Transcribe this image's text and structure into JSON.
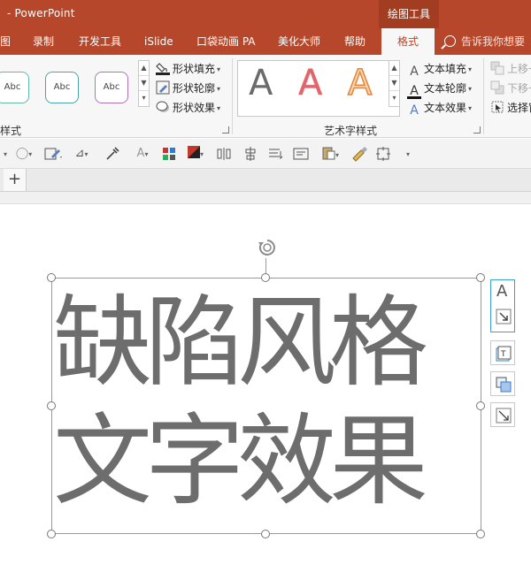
{
  "titlebar": {
    "title": "- PowerPoint",
    "context_group": "绘图工具"
  },
  "tabs": [
    {
      "label": "图",
      "active": false
    },
    {
      "label": "录制",
      "active": false
    },
    {
      "label": "开发工具",
      "active": false
    },
    {
      "label": "iSlide",
      "active": false
    },
    {
      "label": "口袋动画 PA",
      "active": false
    },
    {
      "label": "美化大师",
      "active": false
    },
    {
      "label": "帮助",
      "active": false
    },
    {
      "label": "格式",
      "active": true
    }
  ],
  "tell_me": "告诉我你想要",
  "shape_styles": {
    "thumbs": [
      {
        "label": "Abc",
        "border": "#5fb9a4"
      },
      {
        "label": "Abc",
        "border": "#4aa3a8"
      },
      {
        "label": "Abc",
        "border": "#b46fc0"
      }
    ],
    "fill": "形状填充",
    "outline": "形状轮廓",
    "effects": "形状效果",
    "group_label": "样式"
  },
  "wordart": {
    "samples": [
      {
        "letter": "A",
        "style": "gray"
      },
      {
        "letter": "A",
        "style": "red"
      },
      {
        "letter": "A",
        "style": "orange-outline"
      }
    ],
    "fill": "文本填充",
    "outline": "文本轮廓",
    "effects": "文本效果",
    "group_label": "艺术字样式"
  },
  "arrange": {
    "bring_forward": "上移一",
    "send_backward": "下移一",
    "selection_pane": "选择窗"
  },
  "slide": {
    "line1": "缺陷风格",
    "line2": "文字效果"
  },
  "colors": {
    "accent": "#b7472a",
    "text_gray": "#6d6d6d"
  }
}
